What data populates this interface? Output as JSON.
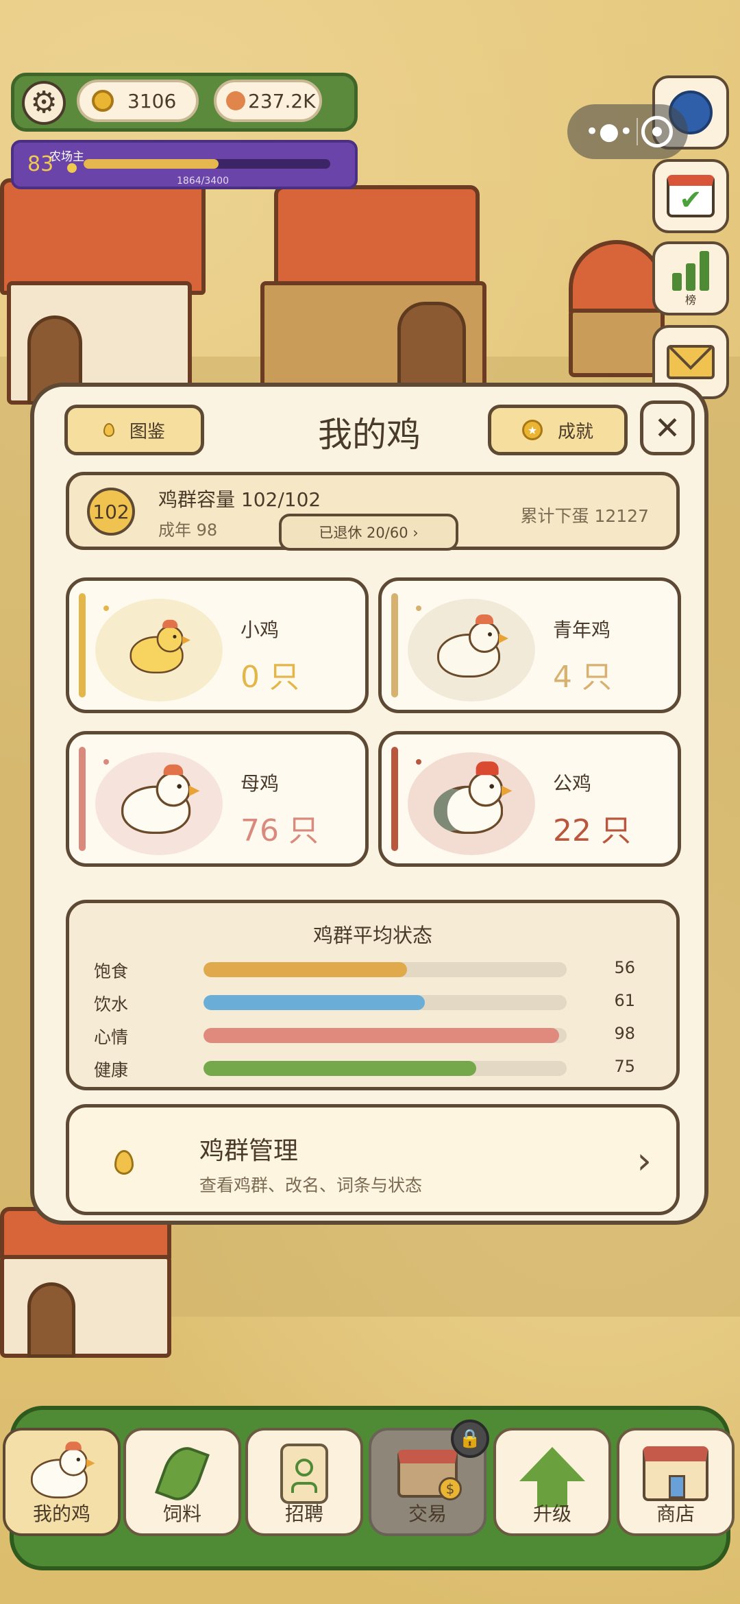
{
  "hud": {
    "coins": "3106",
    "orbs": "237.2K",
    "level": "83",
    "rank_title": "农场主",
    "xp_text": "1864/3400",
    "xp_progress": 0.548
  },
  "side_buttons": {
    "leaderboard_label": "榜"
  },
  "modal": {
    "title": "我的鸡",
    "atlas_label": "图鉴",
    "achievement_label": "成就",
    "close_glyph": "✕",
    "capacity": {
      "badge": "102",
      "title": "鸡群容量 102/102",
      "adults": "成年 98",
      "retired": "已退休 20/60 ›",
      "eggs_total": "累计下蛋 12127"
    },
    "chickens": [
      {
        "name": "小鸡",
        "count": "0 只",
        "color": "#e3b64a"
      },
      {
        "name": "青年鸡",
        "count": "4 只",
        "color": "#d6b170"
      },
      {
        "name": "母鸡",
        "count": "76 只",
        "color": "#d98a7c"
      },
      {
        "name": "公鸡",
        "count": "22 只",
        "color": "#b8563e"
      }
    ],
    "status": {
      "title": "鸡群平均状态",
      "rows": [
        {
          "label": "饱食",
          "value": "56",
          "level": 56,
          "color": "#e0aa4c"
        },
        {
          "label": "饮水",
          "value": "61",
          "level": 61,
          "color": "#6aaed8"
        },
        {
          "label": "心情",
          "value": "98",
          "level": 98,
          "color": "#df8a7c"
        },
        {
          "label": "健康",
          "value": "75",
          "level": 75,
          "color": "#74a84a"
        }
      ]
    },
    "manage": {
      "title": "鸡群管理",
      "subtitle": "查看鸡群、改名、词条与状态",
      "chevron": "›"
    }
  },
  "nav": [
    {
      "label": "我的鸡",
      "icon": "chicken-icon",
      "active": true
    },
    {
      "label": "饲料",
      "icon": "leaf-icon"
    },
    {
      "label": "招聘",
      "icon": "badge-icon"
    },
    {
      "label": "交易",
      "icon": "shop-stall-icon",
      "locked": true
    },
    {
      "label": "升级",
      "icon": "arrow-up-icon"
    },
    {
      "label": "商店",
      "icon": "store-icon"
    }
  ]
}
